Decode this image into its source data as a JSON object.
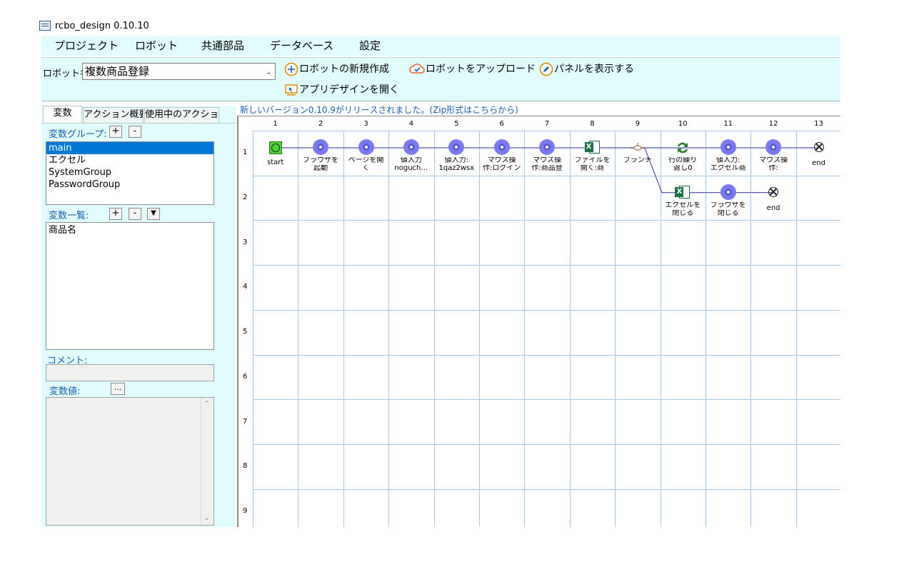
{
  "window": {
    "title": "rcbo_design 0.10.10",
    "icon": "app-window-icon"
  },
  "menu": [
    "プロジェクト",
    "ロボット",
    "共通部品",
    "データベース",
    "設定"
  ],
  "toolbar": {
    "robot_label": "ロボット名",
    "robot_value": "複数商品登録",
    "new_robot": "ロボットの新規作成",
    "upload_robot": "ロボットをアップロード",
    "show_panel": "パネルを表示する",
    "open_app_design": "アプリデザインを開く"
  },
  "left": {
    "tabs": [
      "変数",
      "アクション概要",
      "使用中のアクション"
    ],
    "group_label": "変数グループ:",
    "groups": [
      "main",
      "エクセル",
      "SystemGroup",
      "PasswordGroup"
    ],
    "list_label": "変数一覧:",
    "variables": [
      "商品名"
    ],
    "comment_label": "コメント:",
    "value_label": "変数値:",
    "value_button": "...",
    "plus": "+",
    "minus": "-",
    "dropdown": "▼"
  },
  "notice": "新しいバージョン0.10.9がリリースされました。(Zip形式はこちらから)",
  "flow": {
    "columns": [
      "1",
      "2",
      "3",
      "4",
      "5",
      "6",
      "7",
      "8",
      "9",
      "10",
      "11",
      "12",
      "13"
    ],
    "rows": [
      "1",
      "2",
      "3",
      "4",
      "5",
      "6",
      "7",
      "8",
      "9"
    ],
    "row1": [
      {
        "icon": "start-icon",
        "label1": "start",
        "label2": ""
      },
      {
        "icon": "chrome-icon",
        "label1": "ブラウザを",
        "label2": "起動"
      },
      {
        "icon": "chrome-icon",
        "label1": "ページを開",
        "label2": "く"
      },
      {
        "icon": "chrome-icon",
        "label1": "値入力",
        "label2": "noguch…"
      },
      {
        "icon": "chrome-icon",
        "label1": "値入力:",
        "label2": "1qaz2wsx"
      },
      {
        "icon": "chrome-icon",
        "label1": "マウス操",
        "label2": "作:ログイン"
      },
      {
        "icon": "chrome-icon",
        "label1": "マウス操",
        "label2": "作:商品登"
      },
      {
        "icon": "excel-icon",
        "label1": "ファイルを",
        "label2": "開く:商"
      },
      {
        "icon": "branch-icon",
        "label1": "ブランチ",
        "label2": ""
      },
      {
        "icon": "loop-icon",
        "label1": "行の繰り",
        "label2": "返し0"
      },
      {
        "icon": "chrome-icon",
        "label1": "値入力:",
        "label2": "エクセル商"
      },
      {
        "icon": "chrome-icon",
        "label1": "マウス操",
        "label2": "作:"
      },
      {
        "icon": "end-icon",
        "label1": "end",
        "label2": ""
      }
    ],
    "row2": [
      {
        "icon": "excel-icon",
        "label1": "エクセルを",
        "label2": "閉じる"
      },
      {
        "icon": "chrome-icon",
        "label1": "ブラウザを",
        "label2": "閉じる"
      },
      {
        "icon": "end-icon",
        "label1": "end",
        "label2": ""
      }
    ]
  },
  "colors": {
    "panel_bg": "#e1fcfc",
    "accent_blue": "#1a5fb4",
    "grid": "#a8c8e8",
    "chrome": "#7b79f0",
    "flow_line": "#2a2aa0"
  }
}
